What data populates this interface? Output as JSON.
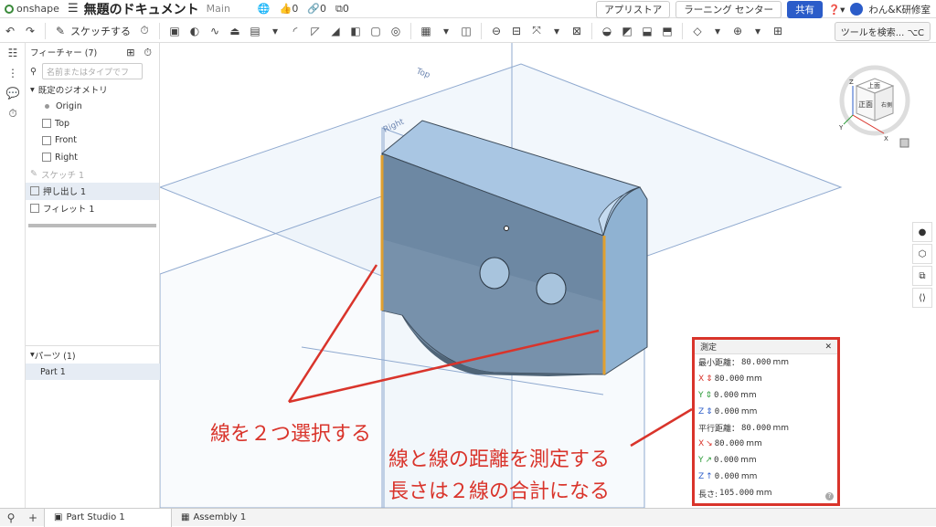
{
  "app": {
    "logo": "onshape",
    "document_title": "無題のドキュメント",
    "workspace": "Main",
    "counts": {
      "likes": "0",
      "links": "0",
      "copies": "0"
    }
  },
  "top_right": {
    "app_store": "アプリストア",
    "learning": "ラーニング センター",
    "share": "共有",
    "user": "わん&K研修室"
  },
  "toolbar": {
    "sketch_label": "スケッチする",
    "search_label": "ツールを検索...",
    "search_shortcut": "⌥C"
  },
  "feature_panel": {
    "title": "フィーチャー (7)",
    "filter_placeholder": "名前またはタイプでフ",
    "default_geometry": "既定のジオメトリ",
    "items_default": [
      "Origin",
      "Top",
      "Front",
      "Right"
    ],
    "features": [
      "スケッチ 1",
      "押し出し 1",
      "フィレット 1"
    ],
    "parts_title": "パーツ (1)",
    "parts": [
      "Part 1"
    ]
  },
  "viewport": {
    "plane_labels": {
      "top": "Top",
      "right": "Right"
    },
    "viewcube": {
      "top": "上面",
      "front": "正面",
      "right": "右側",
      "axes": [
        "Z",
        "Y",
        "X"
      ]
    }
  },
  "measure": {
    "title": "測定",
    "min_distance_label": "最小距離：",
    "min_distance_value": "80.000",
    "parallel_distance_label": "平行距離：",
    "parallel_distance_value": "80.000",
    "unit": "mm",
    "min_components": [
      {
        "axis": "X",
        "value": "80.000"
      },
      {
        "axis": "Y",
        "value": "0.000"
      },
      {
        "axis": "Z",
        "value": "0.000"
      }
    ],
    "parallel_components": [
      {
        "axis": "X",
        "value": "80.000"
      },
      {
        "axis": "Y",
        "value": "0.000"
      },
      {
        "axis": "Z",
        "value": "0.000"
      }
    ],
    "length_label": "長さ:",
    "length_value": "105.000"
  },
  "annotations": {
    "select_two_lines": "線を２つ選択する",
    "measure_distance": "線と線の距離を測定する",
    "length_sum": "長さは２線の合計になる"
  },
  "tabs": [
    "Part Studio 1",
    "Assembly 1"
  ],
  "colors": {
    "accent_red": "#d9342b",
    "edge_orange": "#e0a030",
    "part_blue": "#6d88a3",
    "share_blue": "#2b5cc9"
  }
}
